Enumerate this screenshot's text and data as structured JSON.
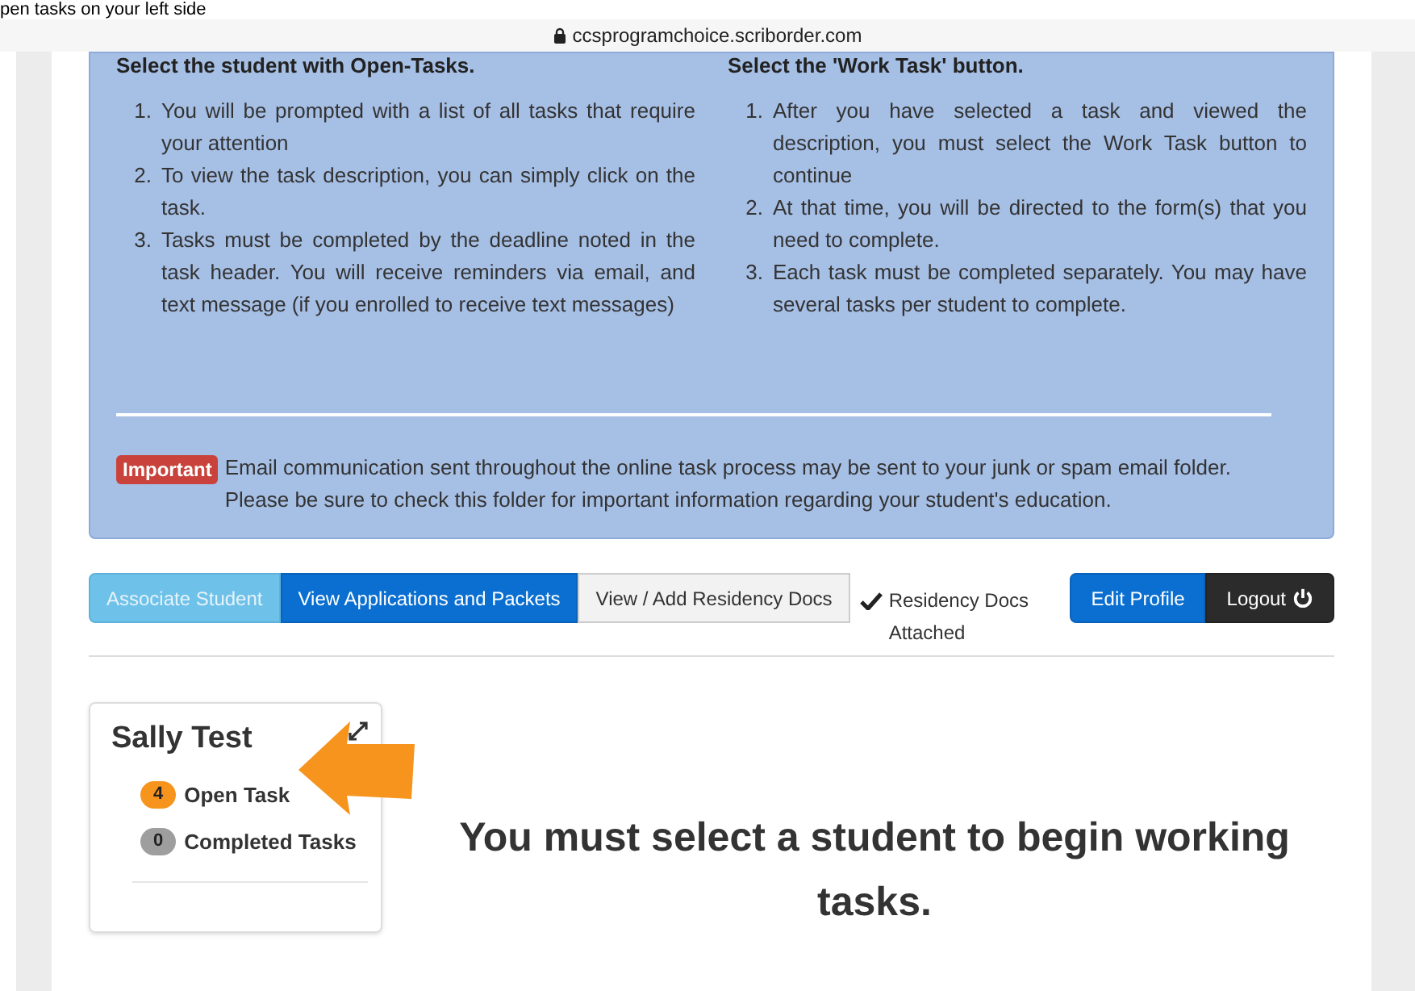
{
  "caption": "pen tasks on your left side",
  "address_bar": {
    "url": "ccsprogramchoice.scriborder.com"
  },
  "instructions": {
    "columns": [
      {
        "heading": "Select the student with Open-Tasks.",
        "steps": [
          {
            "number": "1.",
            "text": "You will be prompted with a list of all tasks that require your attention"
          },
          {
            "number": "2.",
            "text": "To view the task description, you can simply click on the task."
          },
          {
            "number": "3.",
            "text": "Tasks must be completed by the deadline noted in the task header. You will receive reminders via email, and text message (if you enrolled to receive text messages)"
          }
        ]
      },
      {
        "heading": "Select the 'Work Task' button.",
        "steps": [
          {
            "number": "1.",
            "text": "After you have selected a task and viewed the description, you must select the Work Task button to continue"
          },
          {
            "number": "2.",
            "text": "At that time, you will be directed to the form(s) that you need to complete."
          },
          {
            "number": "3.",
            "text": "Each task must be completed separately.  You may have several tasks per student to complete."
          }
        ]
      }
    ],
    "notice": {
      "badge": "Important",
      "text": "Email communication sent throughout the online task process may be sent to your junk or spam email folder. Please be sure to check this folder for important information regarding your student's education."
    }
  },
  "toolbar": {
    "buttons": [
      {
        "label": "Associate Student",
        "kind": "light"
      },
      {
        "label": "View Applications and Packets",
        "kind": "primary"
      },
      {
        "label": "View / Add Residency Docs",
        "kind": "default"
      }
    ],
    "residency_status": "Residency Docs Attached",
    "right_buttons": [
      {
        "label": "Edit Profile",
        "kind": "primary"
      },
      {
        "label": "Logout",
        "kind": "dark"
      }
    ]
  },
  "student": {
    "name": "Sally Test",
    "counts": [
      {
        "count": "4",
        "label": "Open Task",
        "color": "#f7941d"
      },
      {
        "count": "0",
        "label": "Completed Tasks",
        "color": "#9e9e9e"
      }
    ]
  },
  "message": "You must select a student to begin working tasks."
}
